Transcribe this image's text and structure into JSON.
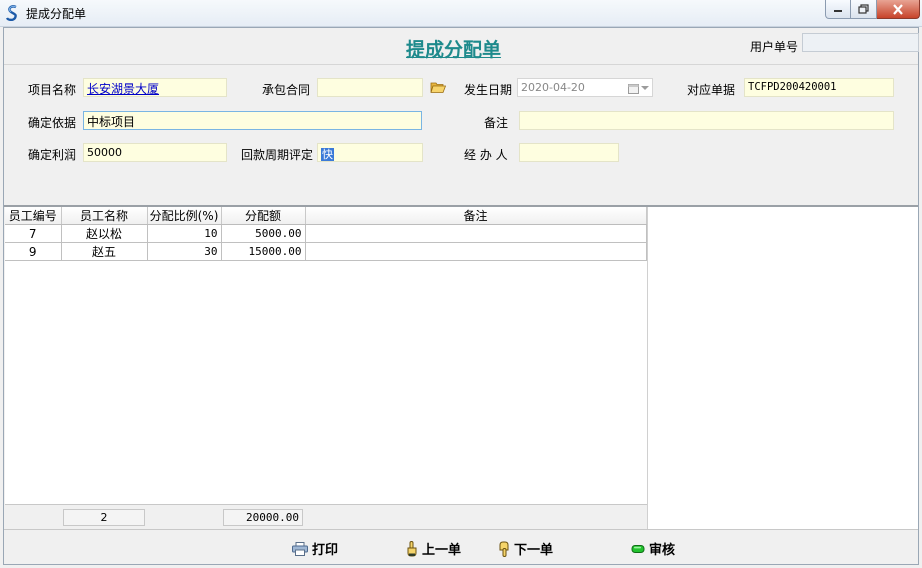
{
  "window": {
    "title": "提成分配单"
  },
  "header": {
    "form_title": "提成分配单",
    "user_no_label": "用户单号",
    "user_no_value": ""
  },
  "form": {
    "project_name_label": "项目名称",
    "project_name_value": "长安湖景大厦",
    "contract_label": "承包合同",
    "contract_value": "",
    "date_label": "发生日期",
    "date_value": "2020-04-20",
    "ref_label": "对应单据",
    "ref_value": "TCFPD200420001",
    "basis_label": "确定依据",
    "basis_value": "中标项目",
    "remark_label": "备注",
    "remark_value": "",
    "profit_label": "确定利润",
    "profit_value": "50000",
    "cycle_label": "回款周期评定",
    "cycle_value": "快",
    "handler_label": "经 办 人",
    "handler_value": ""
  },
  "table": {
    "columns": [
      "员工编号",
      "员工名称",
      "分配比例(%)",
      "分配额",
      "备注"
    ],
    "rows": [
      [
        "7",
        "赵以松",
        "10",
        "5000.00",
        ""
      ],
      [
        "9",
        "赵五",
        "30",
        "15000.00",
        ""
      ]
    ]
  },
  "summary": {
    "count": "2",
    "total": "20000.00"
  },
  "toolbar": {
    "print_label": "打印",
    "prev_label": "上一单",
    "next_label": "下一单",
    "audit_label": "审核"
  }
}
